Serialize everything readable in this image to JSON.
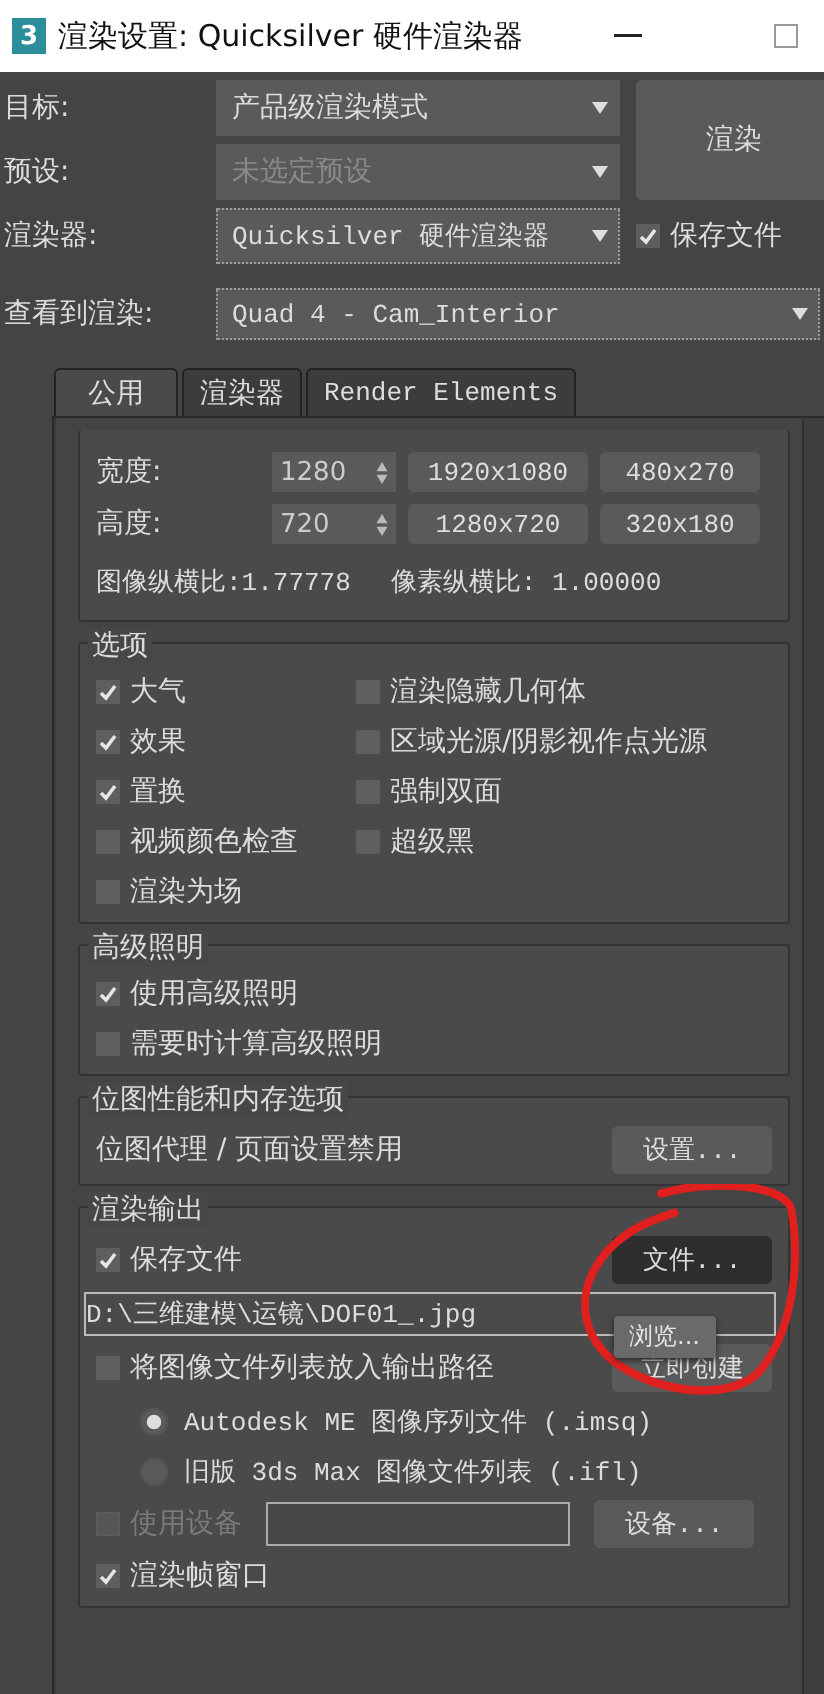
{
  "window": {
    "title": "渲染设置: Quicksilver 硬件渲染器",
    "app_icon": "3"
  },
  "top_rows": [
    {
      "label": "目标:",
      "value": "产品级渲染模式",
      "disabled": false
    },
    {
      "label": "预设:",
      "value": "未选定预设",
      "disabled": true
    },
    {
      "label": "渲染器:",
      "value": "Quicksilver 硬件渲染器",
      "disabled": false
    }
  ],
  "render_button": "渲染",
  "save_file": {
    "label": "保存文件",
    "checked": true
  },
  "view": {
    "label": "查看到渲染:",
    "value": "Quad 4 - Cam_Interior"
  },
  "tabs": [
    {
      "label": "公用",
      "selected": true
    },
    {
      "label": "渲染器",
      "selected": false
    },
    {
      "label": "Render Elements",
      "selected": false
    }
  ],
  "size": {
    "fields": [
      {
        "label": "宽度:",
        "value": "1280"
      },
      {
        "label": "高度:",
        "value": "720"
      }
    ],
    "presets": [
      "1920x1080",
      "480x270",
      "1280x720",
      "320x180"
    ],
    "image_aspect": "图像纵横比:1.77778",
    "pixel_aspect": "像素纵横比: 1.00000"
  },
  "options": {
    "title": "选项",
    "items": [
      {
        "label": "大气",
        "checked": true
      },
      {
        "label": "渲染隐藏几何体",
        "checked": false
      },
      {
        "label": "效果",
        "checked": true
      },
      {
        "label": "区域光源/阴影视作点光源",
        "checked": false
      },
      {
        "label": "置换",
        "checked": true
      },
      {
        "label": "强制双面",
        "checked": false
      },
      {
        "label": "视频颜色检查",
        "checked": false
      },
      {
        "label": "超级黑",
        "checked": false
      },
      {
        "label": "渲染为场",
        "checked": false
      }
    ]
  },
  "advanced_lighting": {
    "title": "高级照明",
    "items": [
      {
        "label": "使用高级照明",
        "checked": true
      },
      {
        "label": "需要时计算高级照明",
        "checked": false
      }
    ]
  },
  "bitmap": {
    "title": "位图性能和内存选项",
    "text": "位图代理 / 页面设置禁用",
    "button": "设置..."
  },
  "output": {
    "title": "渲染输出",
    "save": {
      "label": "保存文件",
      "checked": true
    },
    "files_button": "文件...",
    "path": "D:\\三维建模\\运镜\\DOF01_.jpg",
    "tooltip": "浏览...",
    "file_list": {
      "label": "将图像文件列表放入输出路径",
      "checked": false
    },
    "create_button": "立即创建",
    "formats": [
      {
        "label": "Autodesk ME 图像序列文件 (.imsq)",
        "selected": true
      },
      {
        "label": "旧版 3ds Max 图像文件列表 (.ifl)",
        "selected": false
      }
    ],
    "device": {
      "label": "使用设备",
      "checked": false,
      "disabled": true
    },
    "device_button": "设备...",
    "frame_window": {
      "label": "渲染帧窗口",
      "checked": true
    }
  }
}
